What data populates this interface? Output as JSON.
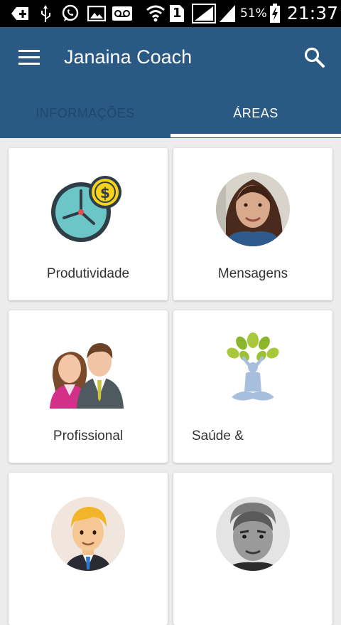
{
  "status_bar": {
    "battery_percent": "51%",
    "time": "21:37",
    "sim_slot": "1",
    "icons": [
      "add-icon",
      "usb-icon",
      "whatsapp-icon",
      "image-icon",
      "voicemail-icon",
      "wifi-icon",
      "sim-icon",
      "signal-icon",
      "signal-icon",
      "battery-charging-icon"
    ]
  },
  "app_bar": {
    "title": "Janaina Coach",
    "menu_icon": "hamburger-menu-icon",
    "search_icon": "search-icon",
    "color": "#2a5a84"
  },
  "tabs": [
    {
      "label": "INFORMAÇÕES",
      "selected": false
    },
    {
      "label": "ÁREAS",
      "selected": true
    }
  ],
  "cards": [
    {
      "label": "Produtividade",
      "icon": "clock-money-icon"
    },
    {
      "label": "Mensagens",
      "icon": "woman-portrait-photo"
    },
    {
      "label": "Profissional",
      "icon": "business-people-icon"
    },
    {
      "label": "Saúde &",
      "icon": "yoga-tree-icon"
    },
    {
      "label": "",
      "icon": "businessman-avatar-icon"
    },
    {
      "label": "",
      "icon": "man-portrait-photo"
    }
  ]
}
